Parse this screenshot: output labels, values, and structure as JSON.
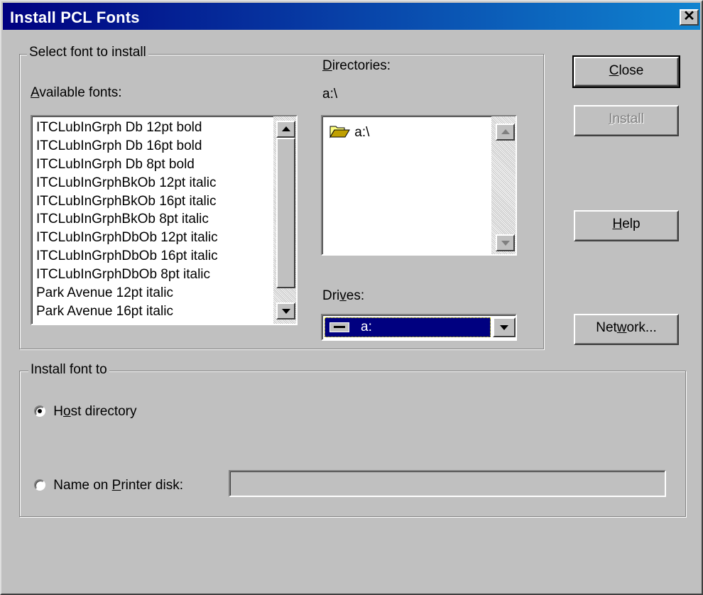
{
  "window": {
    "title": "Install PCL Fonts",
    "close_glyph": "✕"
  },
  "select_group": {
    "legend": "Select font to install",
    "available_fonts_label_pre": "",
    "available_fonts_label_ul": "A",
    "available_fonts_label_post": "vailable fonts:",
    "fonts": [
      "ITCLubInGrph  Db 12pt  bold",
      "ITCLubInGrph  Db 16pt  bold",
      "ITCLubInGrph  Db 8pt  bold",
      "ITCLubInGrphBkOb 12pt  italic",
      "ITCLubInGrphBkOb 16pt  italic",
      "ITCLubInGrphBkOb 8pt  italic",
      "ITCLubInGrphDbOb 12pt  italic",
      "ITCLubInGrphDbOb 16pt  italic",
      "ITCLubInGrphDbOb 8pt  italic",
      "Park Avenue 12pt  italic",
      "Park Avenue 16pt  italic"
    ],
    "directories_label_ul": "D",
    "directories_label_post": "irectories:",
    "current_dir": "a:\\",
    "dir_items": [
      "a:\\"
    ],
    "drives_label_pre": "Dri",
    "drives_label_ul": "v",
    "drives_label_post": "es:",
    "selected_drive": "a:"
  },
  "install_group": {
    "legend": "Install font to",
    "host_pre": "H",
    "host_ul": "o",
    "host_post": "st directory",
    "printer_pre": "Name on ",
    "printer_ul": "P",
    "printer_post": "rinter disk:",
    "printer_disk_value": "",
    "selected_option": "host"
  },
  "buttons": {
    "close_ul": "C",
    "close_post": "lose",
    "install_ul": "I",
    "install_post": "nstall",
    "help_ul": "H",
    "help_post": "elp",
    "network_pre": "Net",
    "network_ul": "w",
    "network_post": "ork..."
  },
  "colors": {
    "titlebar_start": "#000080",
    "titlebar_end": "#1084d0",
    "selection": "#000080",
    "face": "#c0c0c0"
  }
}
